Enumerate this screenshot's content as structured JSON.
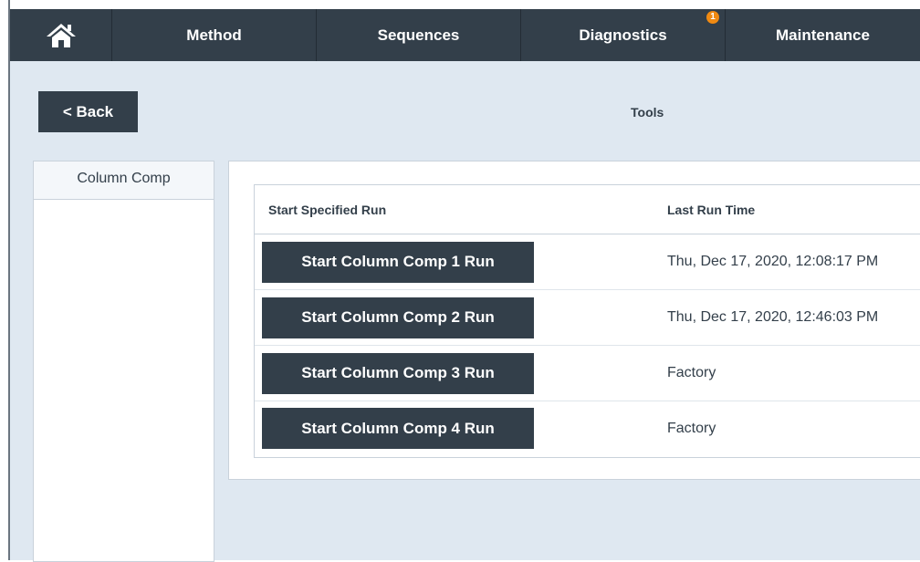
{
  "nav": {
    "home_icon": "home-icon",
    "tabs": [
      {
        "label": "Method"
      },
      {
        "label": "Sequences"
      },
      {
        "label": "Diagnostics",
        "badge": "1"
      },
      {
        "label": "Maintenance"
      }
    ]
  },
  "header": {
    "back_label": "< Back",
    "title": "Tools"
  },
  "sidebar": {
    "items": [
      {
        "label": "Column Comp"
      }
    ]
  },
  "table": {
    "headers": [
      "Start Specified Run",
      "Last Run Time"
    ],
    "rows": [
      {
        "button": "Start Column Comp 1 Run",
        "last_run": "Thu, Dec 17, 2020, 12:08:17 PM"
      },
      {
        "button": "Start Column Comp 2 Run",
        "last_run": "Thu, Dec 17, 2020, 12:46:03 PM"
      },
      {
        "button": "Start Column Comp 3 Run",
        "last_run": "Factory"
      },
      {
        "button": "Start Column Comp 4 Run",
        "last_run": "Factory"
      }
    ]
  },
  "colors": {
    "nav_bg": "#333f4a",
    "content_bg": "#dfe8f1",
    "badge": "#f08a12"
  }
}
